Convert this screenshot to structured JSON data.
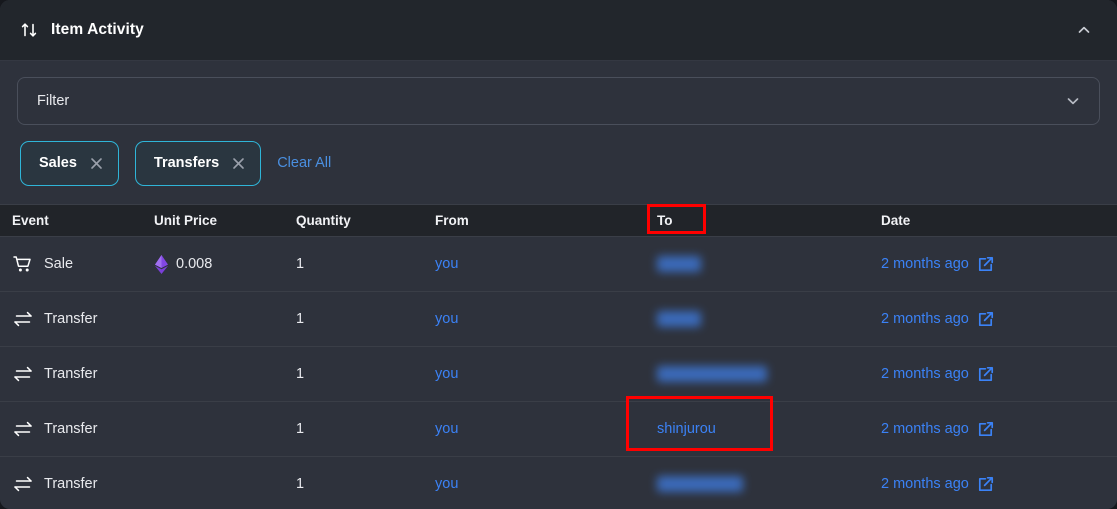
{
  "header": {
    "title": "Item Activity",
    "icon": "transfer-arrows-icon",
    "collapse_icon": "chevron-up-icon"
  },
  "filter": {
    "label": "Filter",
    "placeholder": "Filter",
    "chevron_icon": "chevron-down-icon",
    "chips": [
      {
        "label": "Sales",
        "close_icon": "close-x-icon"
      },
      {
        "label": "Transfers",
        "close_icon": "close-x-icon"
      }
    ],
    "clear_all_label": "Clear All"
  },
  "table": {
    "columns": [
      "Event",
      "Unit Price",
      "Quantity",
      "From",
      "To",
      "Date"
    ],
    "rows": [
      {
        "event": "Sale",
        "event_icon": "shopping-cart-icon",
        "unit_price": "0.008",
        "currency_icon": "ethereum-icon",
        "quantity": "1",
        "from": "you",
        "to": "",
        "to_redacted": true,
        "to_redacted_width": 44,
        "date": "2 months ago",
        "date_icon": "external-link-icon"
      },
      {
        "event": "Transfer",
        "event_icon": "transfer-arrows-icon",
        "unit_price": "",
        "currency_icon": "",
        "quantity": "1",
        "from": "you",
        "to": "",
        "to_redacted": true,
        "to_redacted_width": 44,
        "date": "2 months ago",
        "date_icon": "external-link-icon"
      },
      {
        "event": "Transfer",
        "event_icon": "transfer-arrows-icon",
        "unit_price": "",
        "currency_icon": "",
        "quantity": "1",
        "from": "you",
        "to": "",
        "to_redacted": true,
        "to_redacted_width": 110,
        "date": "2 months ago",
        "date_icon": "external-link-icon"
      },
      {
        "event": "Transfer",
        "event_icon": "transfer-arrows-icon",
        "unit_price": "",
        "currency_icon": "",
        "quantity": "1",
        "from": "you",
        "to": "shinjurou",
        "to_redacted": false,
        "to_redacted_width": 0,
        "date": "2 months ago",
        "date_icon": "external-link-icon"
      },
      {
        "event": "Transfer",
        "event_icon": "transfer-arrows-icon",
        "unit_price": "",
        "currency_icon": "",
        "quantity": "1",
        "from": "you",
        "to": "",
        "to_redacted": true,
        "to_redacted_width": 86,
        "date": "2 months ago",
        "date_icon": "external-link-icon"
      }
    ]
  },
  "annotations": {
    "highlight_color": "#ff0000",
    "boxes": [
      {
        "target": "to-column-header"
      },
      {
        "target": "to-cell-shinjurou"
      }
    ]
  },
  "colors": {
    "panel_bg": "#2e323c",
    "header_bg": "#22262c",
    "table_head_bg": "#212429",
    "link": "#3b82f6",
    "chip_border": "#2fb5d8",
    "clear_all": "#4a8fe0",
    "eth_purple": "#8247e5"
  }
}
